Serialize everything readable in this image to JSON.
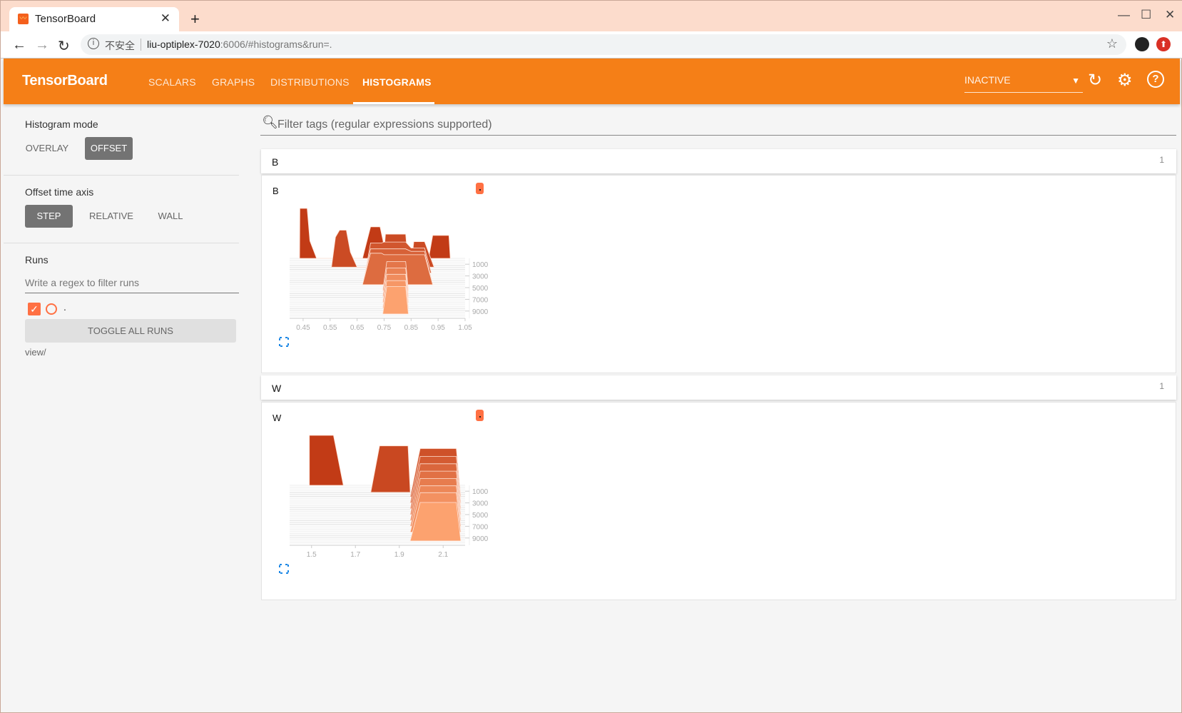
{
  "browser": {
    "tab_title": "TensorBoard",
    "url_insecure_label": "不安全",
    "url_host": "liu-optiplex-7020",
    "url_rest": ":6006/#histograms&run=."
  },
  "header": {
    "brand": "TensorBoard",
    "nav": [
      "SCALARS",
      "GRAPHS",
      "DISTRIBUTIONS",
      "HISTOGRAMS"
    ],
    "active_nav": "HISTOGRAMS",
    "run_select": "INACTIVE",
    "accent_color": "#f57f17"
  },
  "sidebar": {
    "histogram_mode_label": "Histogram mode",
    "histogram_modes": [
      "OVERLAY",
      "OFFSET"
    ],
    "histogram_mode_selected": "OFFSET",
    "time_axis_label": "Offset time axis",
    "time_axis_modes": [
      "STEP",
      "RELATIVE",
      "WALL"
    ],
    "time_axis_selected": "STEP",
    "runs_label": "Runs",
    "runs_filter_placeholder": "Write a regex to filter runs",
    "runs": [
      {
        "name": ".",
        "checked": true,
        "color": "#ff7043"
      }
    ],
    "toggle_all_label": "TOGGLE ALL RUNS",
    "logdir": "view/"
  },
  "main": {
    "filter_placeholder": "Filter tags (regular expressions supported)",
    "categories": [
      {
        "name": "B",
        "count": "1",
        "card_title": "B"
      },
      {
        "name": "W",
        "count": "1",
        "card_title": "W"
      }
    ]
  },
  "chart_data": [
    {
      "type": "histogram-offset",
      "title": "B",
      "xlim": [
        0.4,
        1.05
      ],
      "x_ticks": [
        "0.45",
        "0.55",
        "0.65",
        "0.75",
        "0.85",
        "0.95",
        "1.05"
      ],
      "y_ticks": [
        "1000",
        "3000",
        "5000",
        "7000",
        "9000"
      ],
      "ylim": [
        0,
        10000
      ],
      "color_early": "#c23b16",
      "color_late": "#ffa774",
      "slices": [
        {
          "step": 0,
          "points": [
            [
              0.437,
              0
            ],
            [
              0.438,
              1.0
            ],
            [
              0.465,
              1.0
            ],
            [
              0.475,
              0.35
            ],
            [
              0.5,
              0
            ],
            [
              0.67,
              0
            ],
            [
              0.7,
              0.63
            ],
            [
              0.735,
              0.63
            ],
            [
              0.76,
              0
            ],
            [
              0.915,
              0
            ],
            [
              0.93,
              0.46
            ],
            [
              0.99,
              0.46
            ],
            [
              0.995,
              0
            ]
          ]
        },
        {
          "step": 1500,
          "points": [
            [
              0.555,
              0
            ],
            [
              0.57,
              0.6
            ],
            [
              0.585,
              0.74
            ],
            [
              0.61,
              0.74
            ],
            [
              0.625,
              0.3
            ],
            [
              0.65,
              0
            ],
            [
              0.745,
              0
            ],
            [
              0.755,
              0.66
            ],
            [
              0.83,
              0.66
            ],
            [
              0.84,
              0
            ],
            [
              0.85,
              0
            ],
            [
              0.86,
              0.51
            ],
            [
              0.9,
              0.51
            ],
            [
              0.935,
              0
            ]
          ]
        },
        {
          "step": 2500,
          "points": [
            [
              0.68,
              0
            ],
            [
              0.7,
              0.6
            ],
            [
              0.74,
              0.6
            ],
            [
              0.75,
              0.62
            ],
            [
              0.83,
              0.62
            ],
            [
              0.85,
              0.5
            ],
            [
              0.9,
              0.5
            ],
            [
              0.925,
              0
            ]
          ]
        },
        {
          "step": 3500,
          "points": [
            [
              0.675,
              0
            ],
            [
              0.7,
              0.6
            ],
            [
              0.74,
              0.6
            ],
            [
              0.75,
              0.6
            ],
            [
              0.83,
              0.6
            ],
            [
              0.85,
              0.55
            ],
            [
              0.9,
              0.55
            ],
            [
              0.925,
              0
            ]
          ]
        },
        {
          "step": 4500,
          "points": [
            [
              0.67,
              0
            ],
            [
              0.7,
              0.63
            ],
            [
              0.74,
              0.63
            ],
            [
              0.75,
              0.6
            ],
            [
              0.83,
              0.6
            ],
            [
              0.845,
              0.6
            ],
            [
              0.9,
              0.6
            ],
            [
              0.93,
              0
            ]
          ]
        },
        {
          "step": 5500,
          "points": [
            [
              0.745,
              0
            ],
            [
              0.76,
              0.58
            ],
            [
              0.83,
              0.58
            ],
            [
              0.84,
              0
            ]
          ]
        },
        {
          "step": 6500,
          "points": [
            [
              0.745,
              0
            ],
            [
              0.76,
              0.57
            ],
            [
              0.83,
              0.57
            ],
            [
              0.84,
              0
            ]
          ]
        },
        {
          "step": 7500,
          "points": [
            [
              0.745,
              0
            ],
            [
              0.76,
              0.56
            ],
            [
              0.83,
              0.56
            ],
            [
              0.84,
              0
            ]
          ]
        },
        {
          "step": 8500,
          "points": [
            [
              0.745,
              0
            ],
            [
              0.76,
              0.55
            ],
            [
              0.83,
              0.55
            ],
            [
              0.84,
              0
            ]
          ]
        },
        {
          "step": 9500,
          "points": [
            [
              0.745,
              0
            ],
            [
              0.76,
              0.55
            ],
            [
              0.83,
              0.55
            ],
            [
              0.84,
              0
            ]
          ]
        }
      ]
    },
    {
      "type": "histogram-offset",
      "title": "W",
      "xlim": [
        1.4,
        2.2
      ],
      "x_ticks": [
        "1.5",
        "1.7",
        "1.9",
        "2.1"
      ],
      "y_ticks": [
        "1000",
        "3000",
        "5000",
        "7000",
        "9000"
      ],
      "ylim": [
        0,
        10000
      ],
      "color_early": "#c23b16",
      "color_late": "#ffa774",
      "slices": [
        {
          "step": 0,
          "points": [
            [
              1.49,
              0
            ],
            [
              1.49,
              1.0
            ],
            [
              1.6,
              1.0
            ],
            [
              1.645,
              0
            ]
          ]
        },
        {
          "step": 1200,
          "points": [
            [
              1.77,
              0
            ],
            [
              1.81,
              0.93
            ],
            [
              1.94,
              0.93
            ],
            [
              1.95,
              0
            ]
          ]
        },
        {
          "step": 2000,
          "points": [
            [
              1.95,
              0
            ],
            [
              1.995,
              0.97
            ],
            [
              2.16,
              0.97
            ],
            [
              2.18,
              0
            ]
          ]
        },
        {
          "step": 3000,
          "points": [
            [
              1.95,
              0
            ],
            [
              1.995,
              0.93
            ],
            [
              2.16,
              0.93
            ],
            [
              2.18,
              0
            ]
          ]
        },
        {
          "step": 4000,
          "points": [
            [
              1.95,
              0
            ],
            [
              1.995,
              0.9
            ],
            [
              2.16,
              0.9
            ],
            [
              2.18,
              0
            ]
          ]
        },
        {
          "step": 5000,
          "points": [
            [
              1.95,
              0
            ],
            [
              1.995,
              0.87
            ],
            [
              2.16,
              0.87
            ],
            [
              2.18,
              0
            ]
          ]
        },
        {
          "step": 6000,
          "points": [
            [
              1.95,
              0
            ],
            [
              1.995,
              0.84
            ],
            [
              2.16,
              0.84
            ],
            [
              2.18,
              0
            ]
          ]
        },
        {
          "step": 7000,
          "points": [
            [
              1.95,
              0
            ],
            [
              1.995,
              0.81
            ],
            [
              2.16,
              0.81
            ],
            [
              2.18,
              0
            ]
          ]
        },
        {
          "step": 8000,
          "points": [
            [
              1.95,
              0
            ],
            [
              1.995,
              0.79
            ],
            [
              2.16,
              0.79
            ],
            [
              2.18,
              0
            ]
          ]
        },
        {
          "step": 9500,
          "points": [
            [
              1.95,
              0
            ],
            [
              1.995,
              0.77
            ],
            [
              2.16,
              0.77
            ],
            [
              2.18,
              0
            ]
          ]
        }
      ]
    }
  ]
}
